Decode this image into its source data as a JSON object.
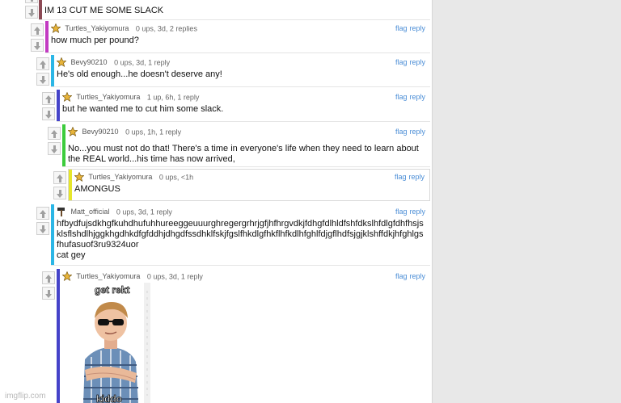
{
  "comments": [
    {
      "id": "c0",
      "user": "",
      "stats": "",
      "text": "IM 13 CUT ME SOME SLACK",
      "bar_color": "#8c4a55"
    },
    {
      "id": "c1",
      "user": "Turtles_Yakiyomura",
      "stats": "0 ups, 3d, 2 replies",
      "text": "how much per pound?",
      "bar_color": "#c23bc2",
      "avatar": "star-icon"
    },
    {
      "id": "c2",
      "user": "Bevy90210",
      "stats": "0 ups, 3d, 1 reply",
      "text": "He's old enough...he doesn't deserve any!",
      "bar_color": "#2bb6e6",
      "avatar": "star-icon"
    },
    {
      "id": "c3",
      "user": "Turtles_Yakiyomura",
      "stats": "1 up, 6h, 1 reply",
      "text": "but he wanted me to cut him some slack.",
      "bar_color": "#4543c9",
      "avatar": "star-icon"
    },
    {
      "id": "c4",
      "user": "Bevy90210",
      "stats": "0 ups, 1h, 1 reply",
      "text": "No...you must not do that! There's a time in everyone's life when they need to learn about the REAL world...his time has now arrived,",
      "bar_color": "#3ccc3c",
      "avatar": "star-icon"
    },
    {
      "id": "c5",
      "user": "Turtles_Yakiyomura",
      "stats": "0 ups, <1h",
      "text": "AMONGUS",
      "bar_color": "#e6e62b",
      "avatar": "star-icon"
    },
    {
      "id": "c6",
      "user": "Matt_official",
      "stats": "0 ups, 3d, 1 reply",
      "text": "hfbydfujsdkhgfkuhdhufuhhureeggeuuurghregergrhrjgfjhfhrgvdkjfdhgfdlhldfshfdkslhfdlgfdhfhsjsklsflshdlhjggkhgdhkdfgfddhjdhgdfssdhklfskjfgslfhkdlgfhkflhfkdlhfghlfdjgflhdfsjgjklshffdkjhfghlgsfhufasuof3ru9324uor",
      "text2": "cat gey",
      "bar_color": "#2bb6e6",
      "avatar": "hammer-icon"
    },
    {
      "id": "c7",
      "user": "Turtles_Yakiyomura",
      "stats": "0 ups, 3d, 1 reply",
      "text": "",
      "bar_color": "#4543c9",
      "avatar": "star-icon",
      "meme_caption_top": "get rekt",
      "meme_caption_bottom": "kiddo"
    }
  ],
  "actions": {
    "flag": "flag",
    "reply": "reply"
  },
  "watermark": "imgflip.com"
}
